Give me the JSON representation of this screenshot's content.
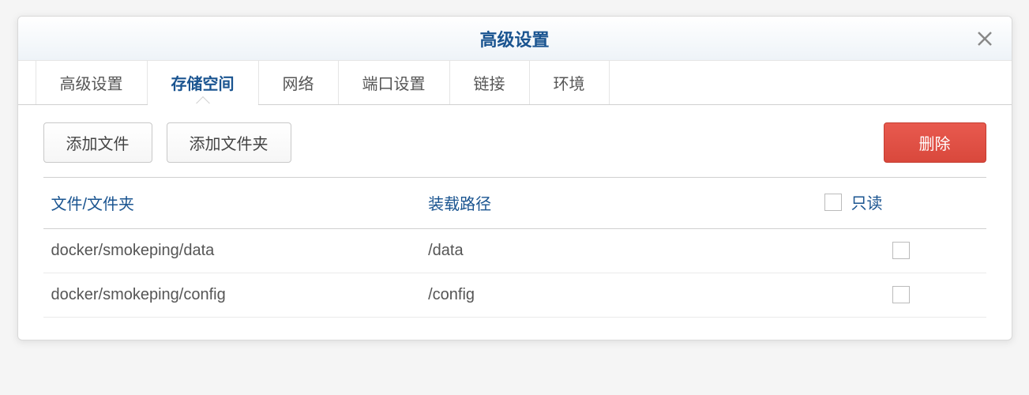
{
  "window": {
    "title": "高级设置"
  },
  "tabs": [
    {
      "id": "advanced",
      "label": "高级设置",
      "active": false
    },
    {
      "id": "storage",
      "label": "存储空间",
      "active": true
    },
    {
      "id": "network",
      "label": "网络",
      "active": false
    },
    {
      "id": "ports",
      "label": "端口设置",
      "active": false
    },
    {
      "id": "links",
      "label": "链接",
      "active": false
    },
    {
      "id": "env",
      "label": "环境",
      "active": false
    }
  ],
  "toolbar": {
    "add_file_label": "添加文件",
    "add_folder_label": "添加文件夹",
    "delete_label": "删除"
  },
  "table": {
    "headers": {
      "path": "文件/文件夹",
      "mount": "装载路径",
      "readonly": "只读"
    },
    "rows": [
      {
        "path": "docker/smokeping/data",
        "mount": "/data",
        "readonly": false
      },
      {
        "path": "docker/smokeping/config",
        "mount": "/config",
        "readonly": false
      }
    ]
  }
}
